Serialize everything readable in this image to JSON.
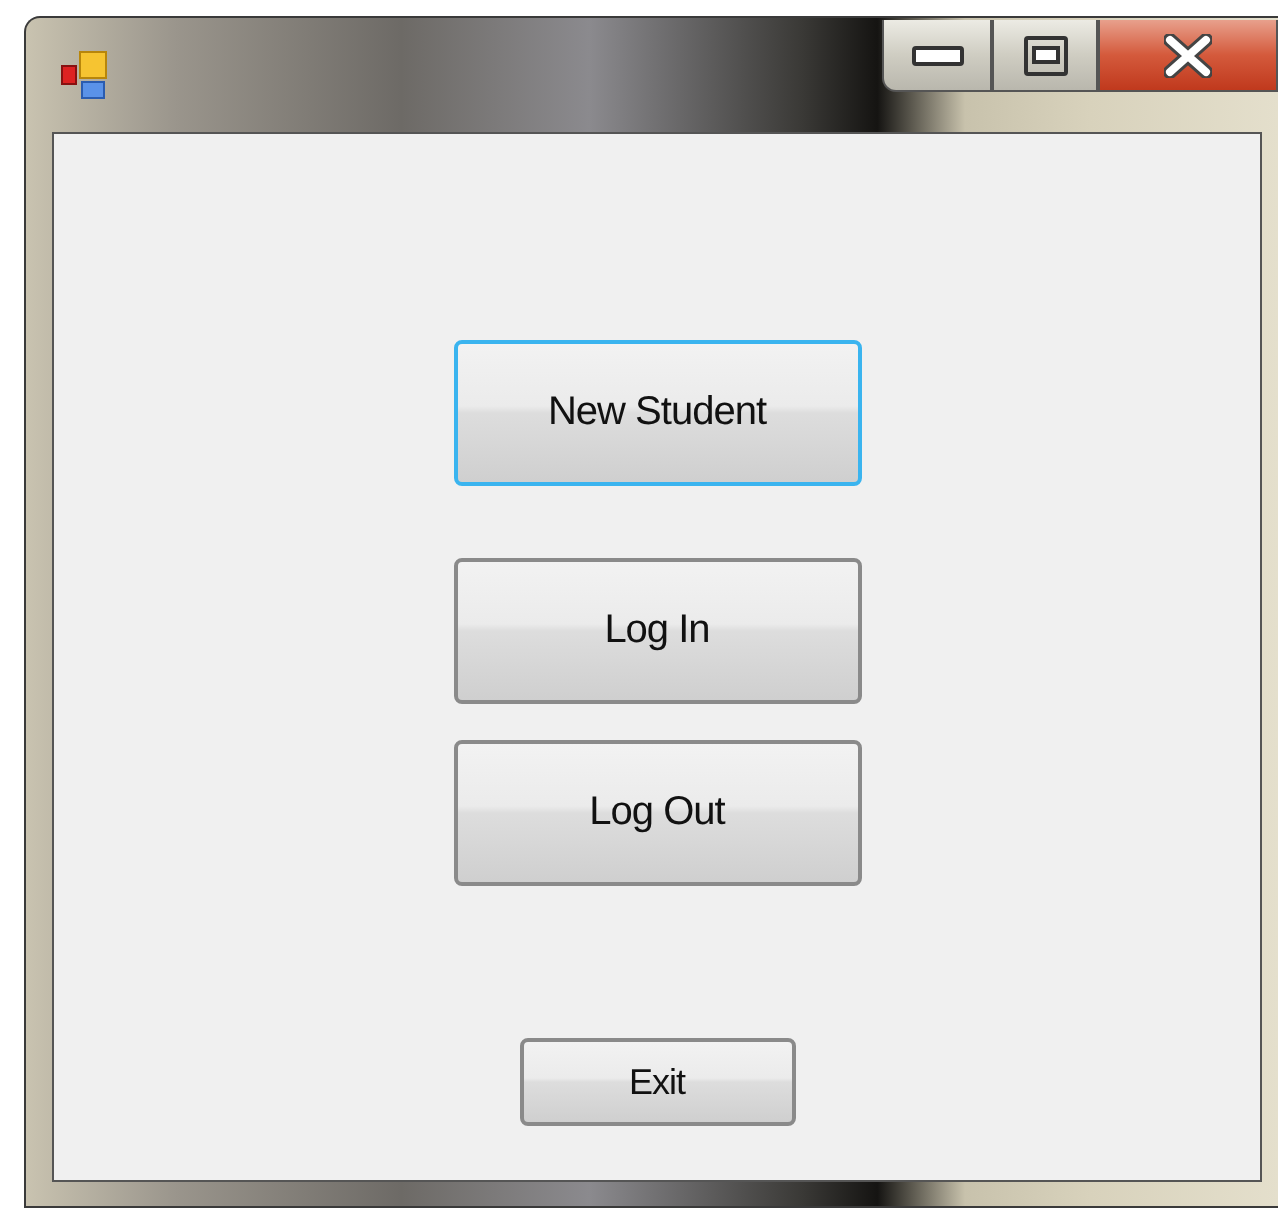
{
  "window": {
    "controls": [
      {
        "kind": "minimize"
      },
      {
        "kind": "maximize"
      },
      {
        "kind": "close"
      }
    ]
  },
  "buttons": [
    {
      "label": "New Student",
      "kind": "large",
      "focused": true
    },
    {
      "label": "Log In",
      "kind": "large",
      "focused": false
    },
    {
      "label": "Log Out",
      "kind": "large",
      "focused": false
    },
    {
      "label": "Exit",
      "kind": "small",
      "focused": false
    }
  ]
}
